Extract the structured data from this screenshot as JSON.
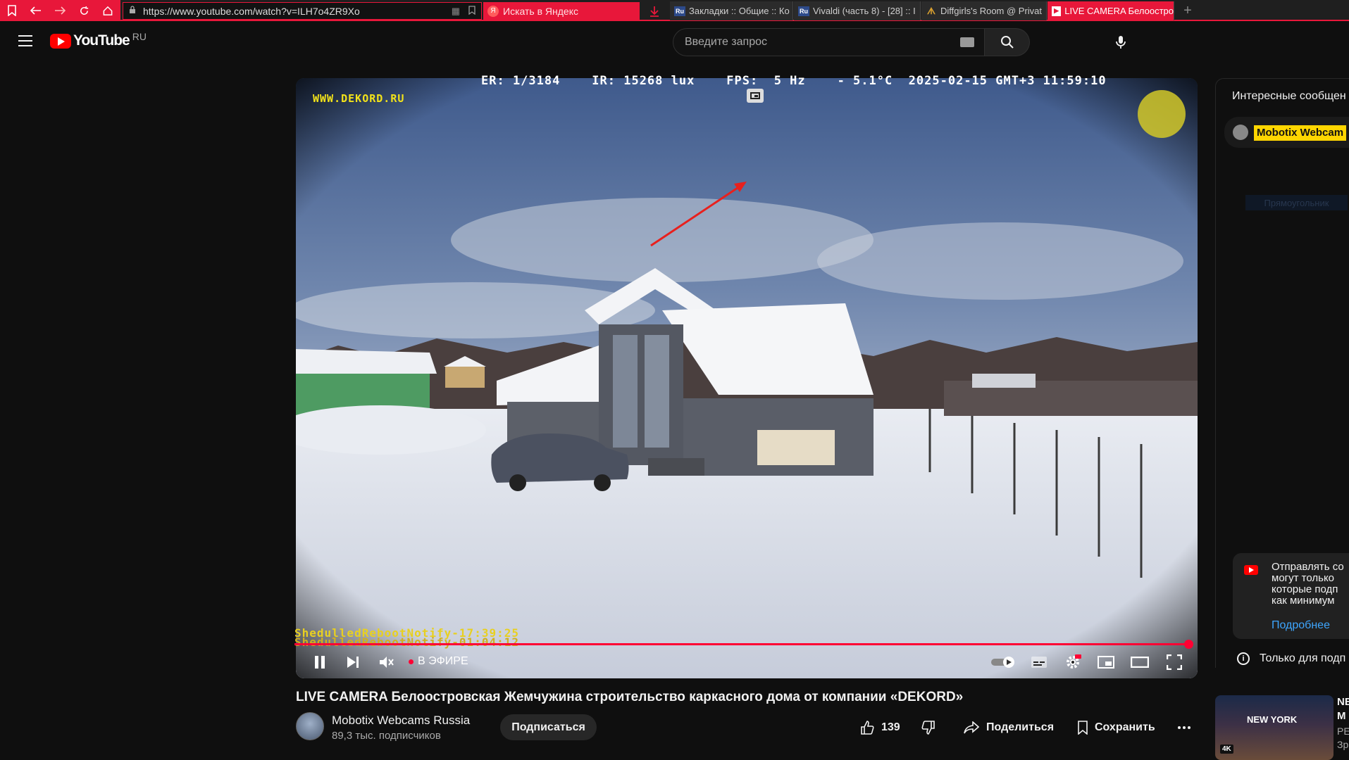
{
  "browser": {
    "url": "https://www.youtube.com/watch?v=ILH7o4ZR9Xo",
    "search_placeholder": "Искать в Яндекс",
    "tabs": [
      {
        "label": "Закладки :: Общие :: Ко",
        "favicon": "Ru"
      },
      {
        "label": "Vivaldi (часть 8) - [28] :: I",
        "favicon": "Ru"
      },
      {
        "label": "Diffgirls's Room @ Privat",
        "favicon": "bird"
      },
      {
        "label": "LIVE CAMERA Белоостро",
        "favicon": "youtube"
      }
    ],
    "accent_color": "#e8173a"
  },
  "youtube": {
    "logo_text": "YouTube",
    "region": "RU",
    "search_placeholder": "Введите запрос"
  },
  "player": {
    "osd_top": "ER: 1/3184    IR: 15268 lux    FPS:  5 Hz    - 5.1°C  2025-02-15 GMT+3 11:59:10",
    "osd_site": "WWW.DEKORD.RU",
    "notify_1": "ShedulledRebootNotify-17:39:25",
    "notify_2": "ShedulledRebootNotify-01:04:12",
    "live_label": "В ЭФИРЕ",
    "progress_fraction": 1.0
  },
  "video": {
    "title": "LIVE CAMERA Белоостровская Жемчужина строительство каркасного дома от компании «DEKORD»",
    "channel": "Mobotix Webcams Russia",
    "subscribers": "89,3 тыс. подписчиков",
    "subscribe_label": "Подписаться",
    "likes": "139",
    "share_label": "Поделиться",
    "save_label": "Сохранить"
  },
  "chat": {
    "header": "Интересные сообщен",
    "pinned_author": "Mobotix Webcam",
    "faded_text": "Прямоугольник",
    "notice_lines": [
      "Отправлять со",
      "могут только",
      "которые подп",
      "как минимум"
    ],
    "notice_more": "Подробнее",
    "footer": "Только для подп"
  },
  "recommendation": {
    "thumb_text": "NEW YORK",
    "badge": "4K",
    "title": "NE M",
    "meta": "PE Зр"
  }
}
